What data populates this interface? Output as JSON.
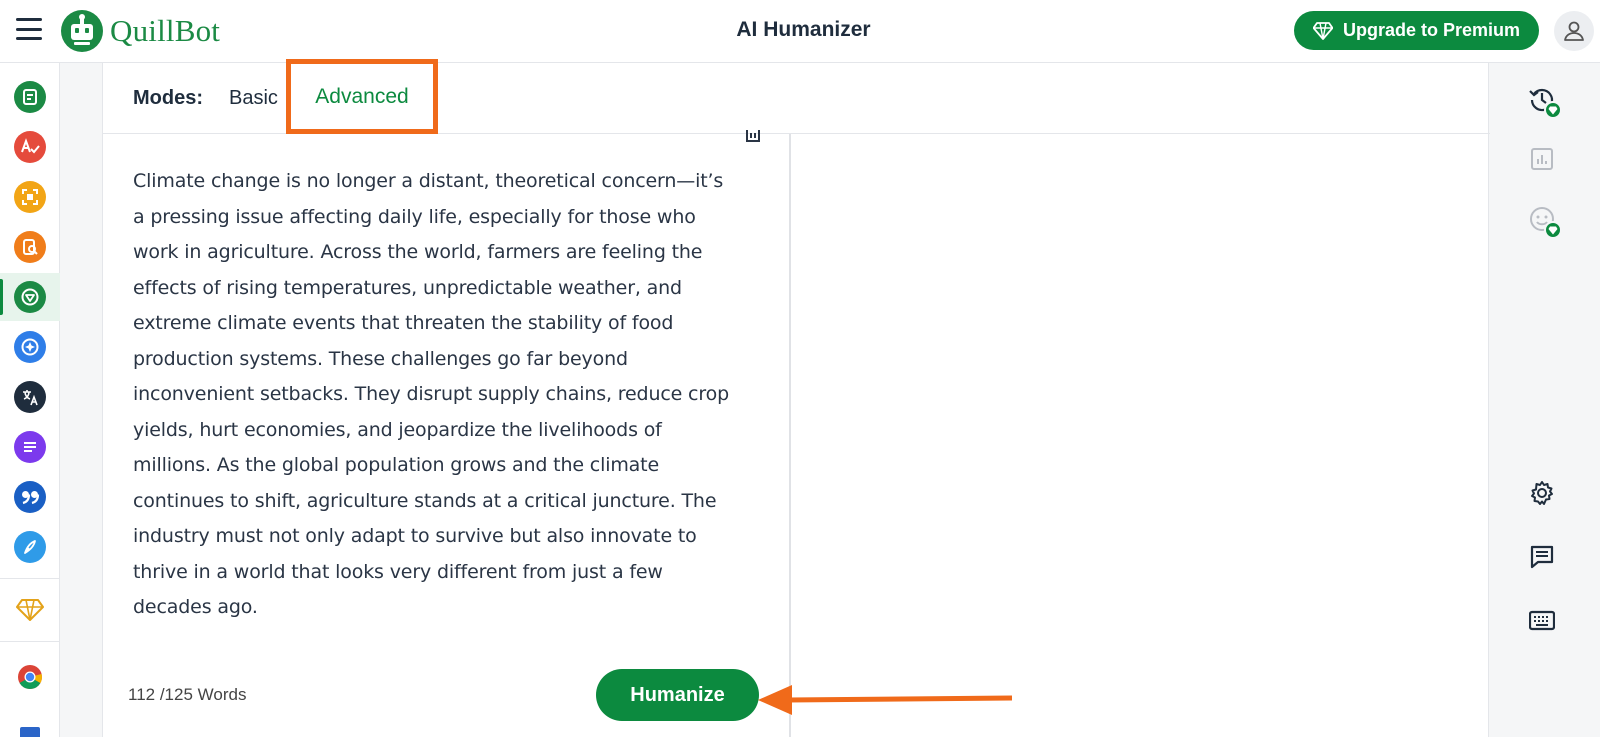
{
  "app": {
    "name": "QuillBot",
    "page_title": "AI Humanizer"
  },
  "header": {
    "upgrade_label": "Upgrade to Premium",
    "menu_icon": "hamburger-menu-icon",
    "user_icon": "user-icon"
  },
  "sidebar": {
    "tools": [
      {
        "name": "paraphraser",
        "icon": "paraphraser-icon",
        "color": "#1b8a44"
      },
      {
        "name": "grammar-checker",
        "icon": "grammar-check-icon",
        "color": "#e54b3c"
      },
      {
        "name": "ai-detector",
        "icon": "ai-detector-icon",
        "color": "#f2a516"
      },
      {
        "name": "plagiarism-checker",
        "icon": "plagiarism-icon",
        "color": "#f07d1a"
      },
      {
        "name": "ai-humanizer",
        "icon": "humanizer-icon",
        "color": "#1b8a44",
        "active": true
      },
      {
        "name": "ai-chat",
        "icon": "chat-ai-icon",
        "color": "#2f7ee8"
      },
      {
        "name": "translator",
        "icon": "translate-icon",
        "color": "#1f2d3d"
      },
      {
        "name": "summarizer",
        "icon": "summarizer-icon",
        "color": "#7c3aed"
      },
      {
        "name": "citation-generator",
        "icon": "quote-icon",
        "color": "#1a5fc4"
      },
      {
        "name": "quillbot-flow",
        "icon": "pen-icon",
        "color": "#2f9be8"
      }
    ],
    "premium_icon": "diamond-icon",
    "chrome_icon": "chrome-icon",
    "word_icon": "word-icon"
  },
  "modes": {
    "label": "Modes:",
    "options": [
      "Basic",
      "Advanced"
    ],
    "selected": "Advanced"
  },
  "editor": {
    "input_text": "Climate change is no longer a distant, theoretical concern—it’s a pressing issue affecting daily life, especially for those who work in agriculture. Across the world, farmers are feeling the effects of rising temperatures, unpredictable weather, and extreme climate events that threaten the stability of food production systems. These challenges go far beyond inconvenient setbacks. They disrupt supply chains, reduce crop yields, hurt economies, and jeopardize the livelihoods of millions. As the global population grows and the climate continues to shift, agriculture stands at a critical juncture. The industry must not only adapt to survive but also innovate to thrive in a world that looks very different from just a few decades ago.",
    "word_count": "112 /125 Words",
    "humanize_label": "Humanize"
  },
  "right_sidebar": {
    "tools": [
      "history-icon",
      "statistics-icon",
      "tone-icon",
      "settings-icon",
      "feedback-icon",
      "keyboard-icon"
    ]
  },
  "colors": {
    "brand_green": "#0c8a3f",
    "highlight_orange": "#f06a1a"
  }
}
